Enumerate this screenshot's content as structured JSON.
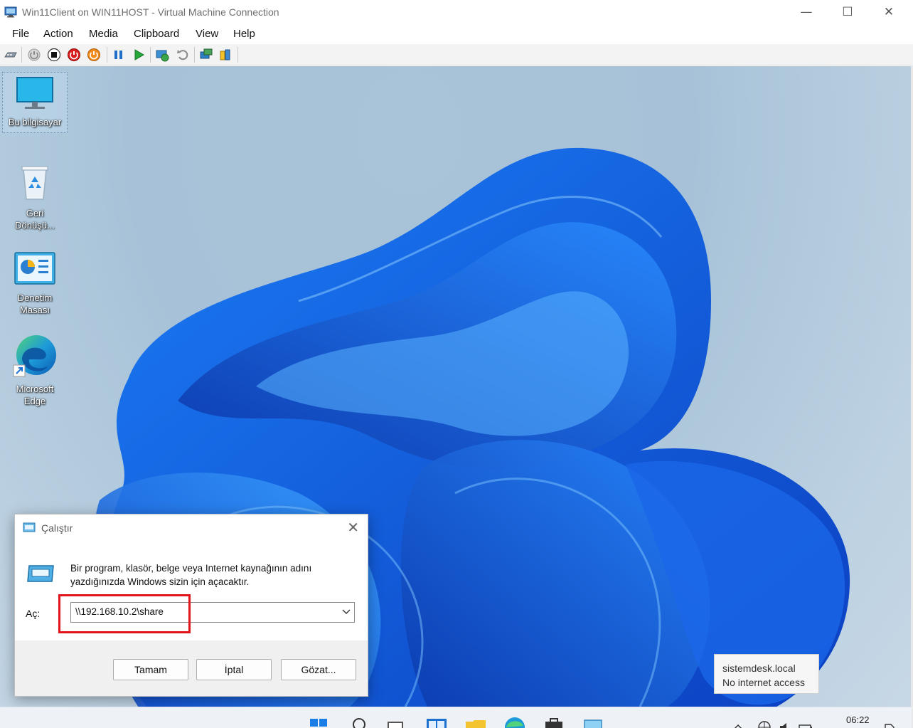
{
  "window": {
    "title": "Win11Client on WIN11HOST - Virtual Machine Connection",
    "minimize_glyph": "—",
    "maximize_glyph": "☐",
    "close_glyph": "✕"
  },
  "menu": {
    "items": [
      "File",
      "Action",
      "Media",
      "Clipboard",
      "View",
      "Help"
    ]
  },
  "toolbar": {
    "icons": [
      "ctrl-alt-del-icon",
      "start-icon",
      "turn-off-icon",
      "shut-down-icon",
      "save-icon",
      "pause-icon",
      "resume-icon",
      "checkpoint-icon",
      "revert-icon",
      "enhanced-session-icon",
      "share-icon"
    ]
  },
  "desktop": {
    "icons": [
      {
        "label_line1": "Bu bilgisayar",
        "label_line2": ""
      },
      {
        "label_line1": "Geri",
        "label_line2": "Dönüşü..."
      },
      {
        "label_line1": "Denetim",
        "label_line2": "Masası"
      },
      {
        "label_line1": "Microsoft",
        "label_line2": "Edge"
      }
    ]
  },
  "run_dialog": {
    "title": "Çalıştır",
    "close_glyph": "✕",
    "description": "Bir program, klasör, belge veya Internet kaynağının adını yazdığınızda Windows sizin için açacaktır.",
    "open_label": "Aç:",
    "input_value": "\\\\192.168.10.2\\share",
    "ok_label": "Tamam",
    "cancel_label": "İptal",
    "browse_label": "Gözat...",
    "highlight_color": "#e0141b"
  },
  "tooltip": {
    "line1": "sistemdesk.local",
    "line2": "No internet access"
  },
  "taskbar": {
    "clock": "06:22"
  }
}
